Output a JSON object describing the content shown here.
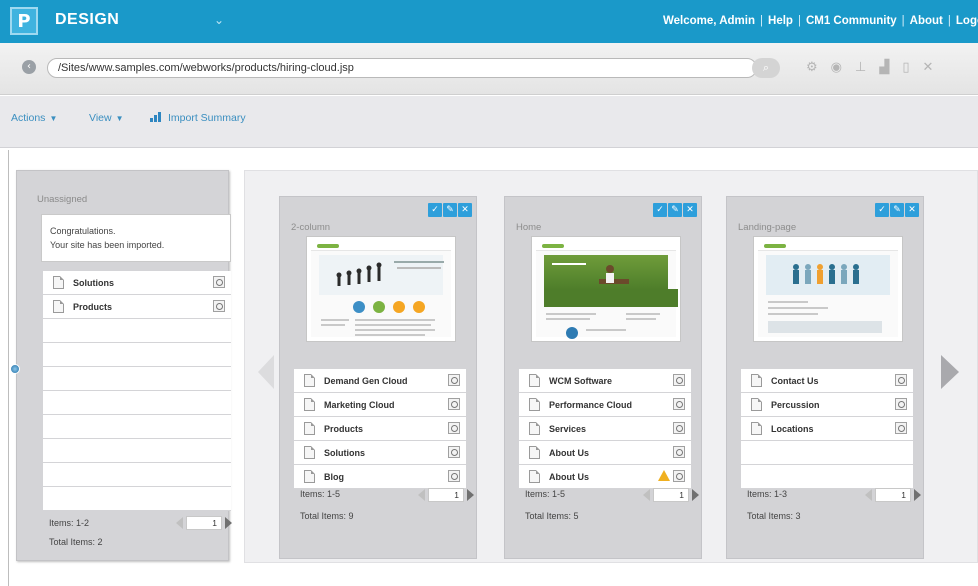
{
  "app": {
    "logo_letter": "P",
    "title": "DESIGN",
    "title_chevron": "⌄",
    "top_links": [
      "Welcome, Admin",
      "Help",
      "CM1 Community",
      "About",
      "Logo"
    ]
  },
  "address": {
    "url": "/Sites/www.samples.com/webworks/products/hiring-cloud.jsp",
    "icons": [
      "gear-icon",
      "eye-icon",
      "sitemap-icon",
      "chart-icon",
      "page-icon",
      "close-icon"
    ]
  },
  "toolbar": {
    "actions_label": "Actions",
    "view_label": "View",
    "import_summary_label": "Import Summary"
  },
  "unassigned": {
    "title": "Unassigned",
    "message_line1": "Congratulations.",
    "message_line2": "Your site has been imported.",
    "pages": [
      "Solutions",
      "Products"
    ],
    "items_label": "Items: 1-2",
    "total_label": "Total Items: 2",
    "page_value": "1"
  },
  "columns": [
    {
      "title": "2-column",
      "pages": [
        {
          "label": "Demand Gen Cloud",
          "warning": false
        },
        {
          "label": "Marketing Cloud",
          "warning": false
        },
        {
          "label": "Products",
          "warning": false
        },
        {
          "label": "Solutions",
          "warning": false
        },
        {
          "label": "Blog",
          "warning": false
        }
      ],
      "items_label": "Items: 1-5",
      "total_label": "Total Items: 9",
      "page_value": "1"
    },
    {
      "title": "Home",
      "pages": [
        {
          "label": "WCM Software",
          "warning": false
        },
        {
          "label": "Performance Cloud",
          "warning": false
        },
        {
          "label": "Services",
          "warning": false
        },
        {
          "label": "About Us",
          "warning": false
        },
        {
          "label": "About Us",
          "warning": true
        }
      ],
      "items_label": "Items: 1-5",
      "total_label": "Total Items: 5",
      "page_value": "1"
    },
    {
      "title": "Landing-page",
      "pages": [
        {
          "label": "Contact Us",
          "warning": false
        },
        {
          "label": "Percussion",
          "warning": false
        },
        {
          "label": "Locations",
          "warning": false
        }
      ],
      "items_label": "Items: 1-3",
      "total_label": "Total Items: 3",
      "page_value": "1"
    }
  ],
  "column_button_glyphs": [
    "✓",
    "✎",
    "✕"
  ],
  "colors": {
    "topbar": "#1a99c9",
    "accent": "#2e9fdb",
    "link": "#3b8fc0",
    "warning": "#f0b020"
  }
}
